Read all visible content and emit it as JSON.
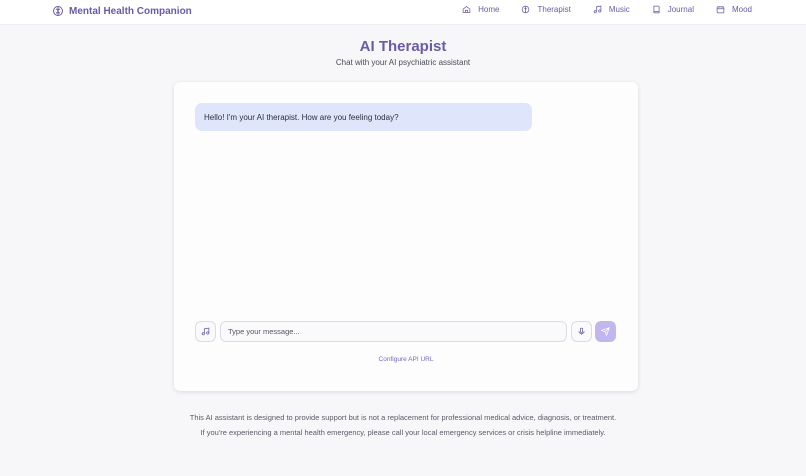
{
  "brand": {
    "title": "Mental Health Companion",
    "icon": "brain-icon"
  },
  "nav": [
    {
      "label": "Home",
      "icon": "home-icon"
    },
    {
      "label": "Therapist",
      "icon": "brain-icon"
    },
    {
      "label": "Music",
      "icon": "music-icon"
    },
    {
      "label": "Journal",
      "icon": "book-icon"
    },
    {
      "label": "Mood",
      "icon": "calendar-icon"
    }
  ],
  "header": {
    "title": "AI Therapist",
    "subtitle": "Chat with your AI psychiatric assistant"
  },
  "chat": {
    "messages": [
      {
        "role": "assistant",
        "text": "Hello! I'm your AI therapist. How are you feeling today?"
      }
    ],
    "input_placeholder": "Type your message...",
    "config_link": "Configure API URL"
  },
  "disclaimer": {
    "line1": "This AI assistant is designed to provide support but is not a replacement for professional medical advice, diagnosis, or treatment.",
    "line2": "If you're experiencing a mental health emergency, please call your local emergency services or crisis helpline immediately."
  },
  "colors": {
    "accent": "#6b5aa6",
    "bubble_bg": "#dfe6fb",
    "send_button": "#c2b6ef",
    "page_bg": "#f7f7f9"
  }
}
